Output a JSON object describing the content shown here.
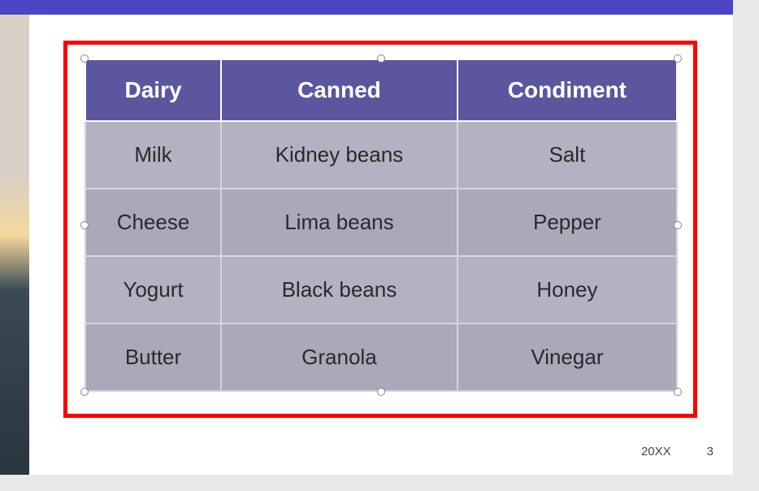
{
  "ribbon": {
    "accent": "#4b44c5"
  },
  "chart_data": {
    "type": "table",
    "headers": [
      "Dairy",
      "Canned",
      "Condiment"
    ],
    "rows": [
      [
        "Milk",
        "Kidney beans",
        "Salt"
      ],
      [
        "Cheese",
        "Lima beans",
        "Pepper"
      ],
      [
        "Yogurt",
        "Black beans",
        "Honey"
      ],
      [
        "Butter",
        "Granola",
        "Vinegar"
      ]
    ]
  },
  "footer": {
    "date": "20XX",
    "page": "3"
  }
}
